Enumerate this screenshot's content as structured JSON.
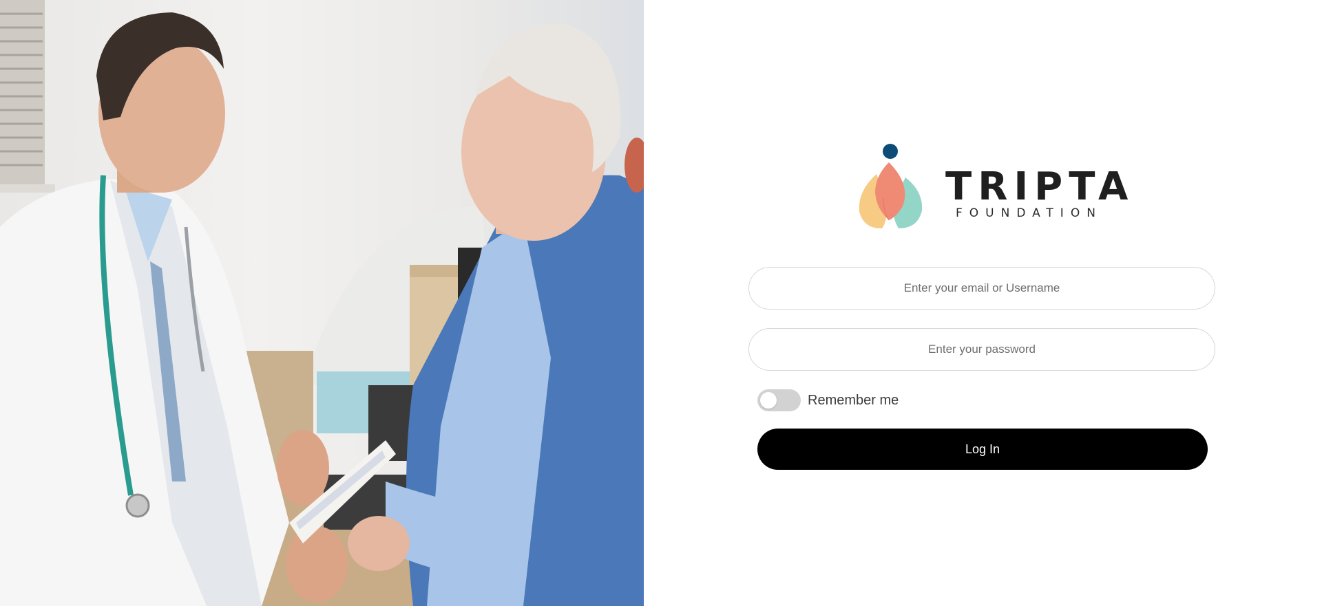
{
  "hero": {
    "image_description": "doctor-consulting-patient-photo"
  },
  "logo": {
    "name": "TRIPTA",
    "subtitle": "FOUNDATION",
    "colors": {
      "dot": "#0e4c78",
      "petal_center": "#ef8a74",
      "petal_left": "#f8cb85",
      "petal_right": "#93d6c7",
      "text": "#1f1f1f"
    }
  },
  "form": {
    "email_placeholder": "Enter your email or Username",
    "password_placeholder": "Enter your password",
    "remember_label": "Remember me",
    "remember_checked": false,
    "submit_label": "Log In"
  },
  "colors": {
    "button_bg": "#000000",
    "button_text": "#ffffff",
    "field_border": "#d6d6d6",
    "toggle_off": "#d2d2d2"
  }
}
